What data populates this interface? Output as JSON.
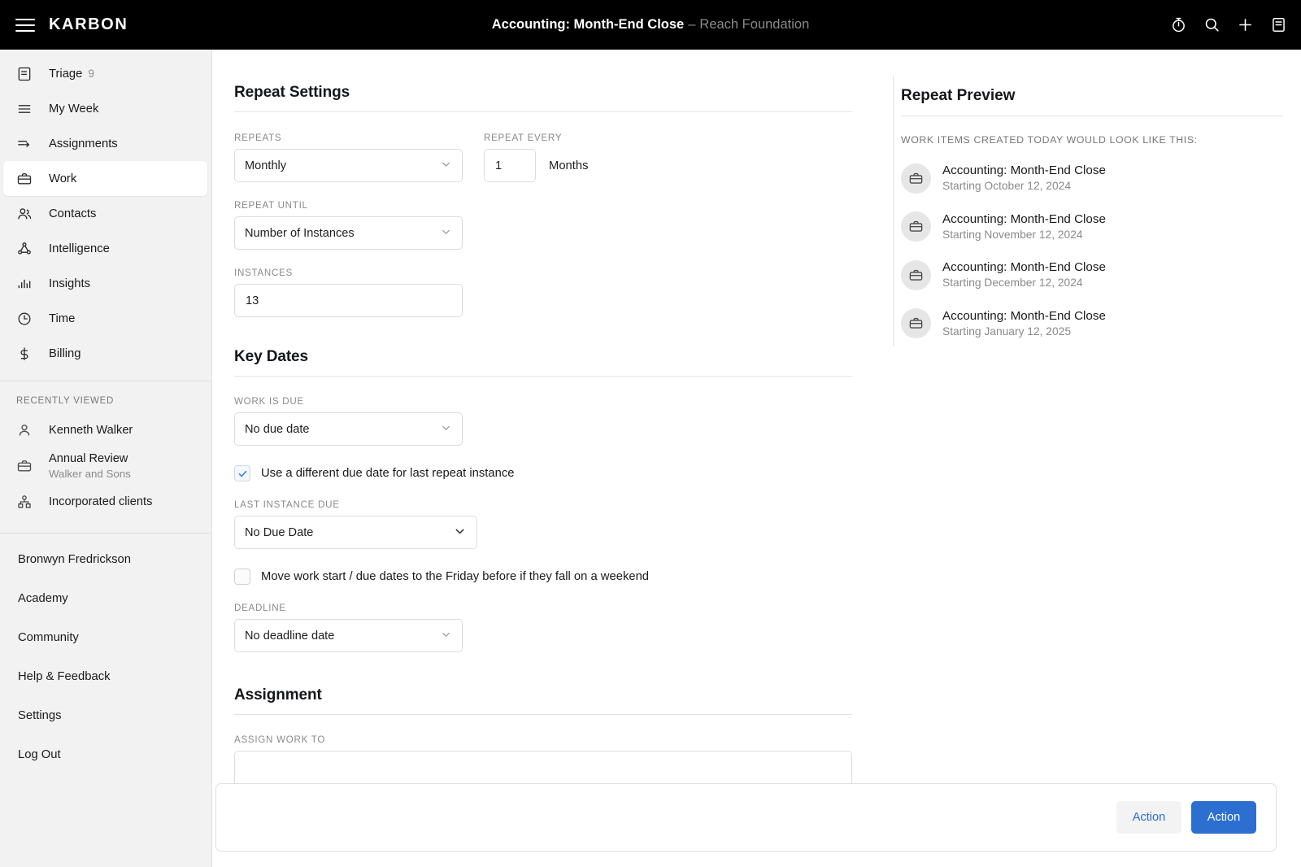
{
  "topbar": {
    "brand": "KARBON",
    "menu_icon": "hamburger-icon",
    "title_main": "Accounting: Month-End Close",
    "title_separator": "–",
    "title_sub": "Reach Foundation",
    "icons": [
      "timer-icon",
      "search-icon",
      "plus-icon",
      "notes-icon"
    ]
  },
  "sidebar": {
    "nav": [
      {
        "label": "Triage",
        "badge": "9",
        "icon": "triage-icon",
        "active": false
      },
      {
        "label": "My Week",
        "badge": "",
        "icon": "my-week-icon",
        "active": false
      },
      {
        "label": "Assignments",
        "badge": "",
        "icon": "assignments-icon",
        "active": false
      },
      {
        "label": "Work",
        "badge": "",
        "icon": "briefcase-icon",
        "active": true
      },
      {
        "label": "Contacts",
        "badge": "",
        "icon": "contacts-icon",
        "active": false
      },
      {
        "label": "Intelligence",
        "badge": "",
        "icon": "intelligence-icon",
        "active": false
      },
      {
        "label": "Insights",
        "badge": "",
        "icon": "insights-icon",
        "active": false
      },
      {
        "label": "Time",
        "badge": "",
        "icon": "clock-icon",
        "active": false
      },
      {
        "label": "Billing",
        "badge": "",
        "icon": "dollar-icon",
        "active": false
      }
    ],
    "recently_viewed_heading": "RECENTLY VIEWED",
    "recently_viewed": [
      {
        "title": "Kenneth Walker",
        "subtitle": "",
        "icon": "person-icon"
      },
      {
        "title": "Annual Review",
        "subtitle": "Walker and Sons",
        "icon": "briefcase-icon"
      },
      {
        "title": "Incorporated clients",
        "subtitle": "",
        "icon": "org-chart-icon"
      }
    ],
    "footer_links": [
      "Bronwyn Fredrickson",
      "Academy",
      "Community",
      "Help & Feedback",
      "Settings",
      "Log Out"
    ]
  },
  "repeat_settings": {
    "title": "Repeat Settings",
    "repeats_label": "REPEATS",
    "repeats_value": "Monthly",
    "repeat_every_label": "REPEAT EVERY",
    "repeat_every_value": "1",
    "repeat_every_unit": "Months",
    "repeat_until_label": "REPEAT UNTIL",
    "repeat_until_value": "Number of Instances",
    "instances_label": "INSTANCES",
    "instances_value": "13"
  },
  "key_dates": {
    "title": "Key Dates",
    "work_is_due_label": "WORK IS DUE",
    "work_is_due_value": "No due date",
    "different_due_date_checkbox": "Use a different due date for last repeat instance",
    "different_due_date_checked": true,
    "last_instance_due_label": "LAST INSTANCE DUE",
    "last_instance_due_value": "No Due Date",
    "weekend_checkbox": "Move work start / due dates to the Friday before if they fall on a weekend",
    "weekend_checked": false,
    "deadline_label": "DEADLINE",
    "deadline_value": "No deadline date"
  },
  "assignment": {
    "title": "Assignment",
    "assign_work_to_label": "ASSIGN WORK TO",
    "assign_work_to_value": ""
  },
  "repeat_preview": {
    "title": "Repeat Preview",
    "caption": "WORK ITEMS CREATED TODAY WOULD LOOK LIKE THIS:",
    "items": [
      {
        "name": "Accounting: Month-End Close",
        "date": "Starting October 12, 2024",
        "icon": "briefcase-icon"
      },
      {
        "name": "Accounting: Month-End Close",
        "date": "Starting November 12, 2024",
        "icon": "briefcase-icon"
      },
      {
        "name": "Accounting: Month-End Close",
        "date": "Starting December 12, 2024",
        "icon": "briefcase-icon"
      },
      {
        "name": "Accounting: Month-End Close",
        "date": "Starting January 12, 2025",
        "icon": "briefcase-icon"
      }
    ]
  },
  "footer": {
    "secondary_label": "Action",
    "primary_label": "Action"
  },
  "colors": {
    "topbar_bg": "#000000",
    "sidebar_bg": "#f2f2f2",
    "primary_button": "#2c6fd1",
    "link_blue": "#2b6cd4",
    "checkbox_check": "#3c7ce0"
  }
}
